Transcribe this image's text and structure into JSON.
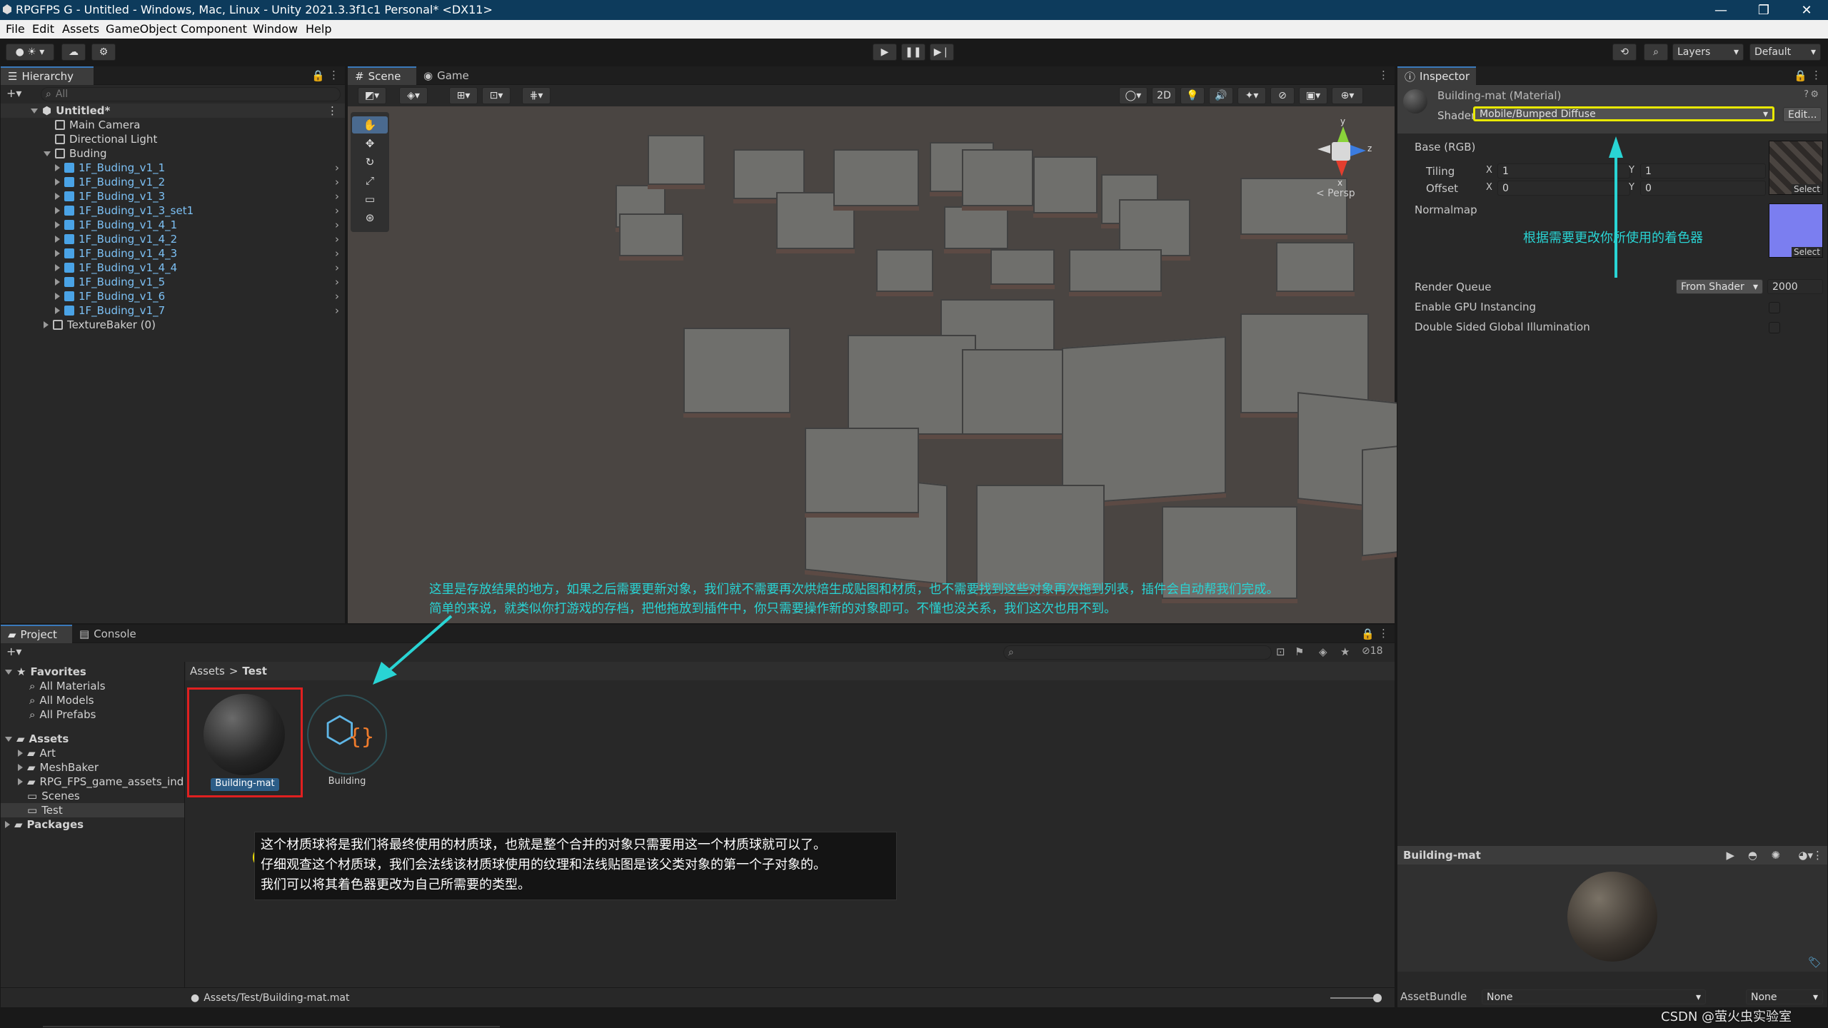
{
  "window": {
    "title": "RPGFPS G - Untitled - Windows, Mac, Linux - Unity 2021.3.3f1c1 Personal* <DX11>",
    "controls": [
      "—",
      "❐",
      "✕"
    ]
  },
  "menu": [
    "File",
    "Edit",
    "Assets",
    "GameObject",
    "Component",
    "Window",
    "Help"
  ],
  "toolbar": {
    "layers_label": "Layers",
    "layout_label": "Default"
  },
  "hierarchy": {
    "tab": "Hierarchy",
    "search_placeholder": "All",
    "scene_name": "Untitled*",
    "items": [
      "Main Camera",
      "Directional Light",
      "Buding"
    ],
    "children": [
      "1F_Buding_v1_1",
      "1F_Buding_v1_2",
      "1F_Buding_v1_3",
      "1F_Buding_v1_3_set1",
      "1F_Buding_v1_4_1",
      "1F_Buding_v1_4_2",
      "1F_Buding_v1_4_3",
      "1F_Buding_v1_4_4",
      "1F_Buding_v1_5",
      "1F_Buding_v1_6",
      "1F_Buding_v1_7"
    ],
    "last_item": "TextureBaker (0)"
  },
  "scene": {
    "tab_scene": "Scene",
    "tab_game": "Game",
    "mode_2d": "2D",
    "persp": "< Persp",
    "gizmo_y": "y",
    "gizmo_z": "z",
    "gizmo_x": "x",
    "annotation_line1": "这里是存放结果的地方，如果之后需要更新对象，我们就不需要再次烘焙生成贴图和材质，也不需要找到这些对象再次拖到列表，插件会自动帮我们完成。",
    "annotation_line2": "简单的来说，就类似你打游戏的存档，把他拖放到插件中，你只需要操作新的对象即可。不懂也没关系，我们这次也用不到。"
  },
  "project": {
    "tab_project": "Project",
    "tab_console": "Console",
    "favorites_label": "Favorites",
    "favorites": [
      "All Materials",
      "All Models",
      "All Prefabs"
    ],
    "assets_label": "Assets",
    "folders": [
      "Art",
      "MeshBaker",
      "RPG_FPS_game_assets_indu",
      "Scenes",
      "Test"
    ],
    "packages_label": "Packages",
    "breadcrumb_root": "Assets",
    "breadcrumb_sep": ">",
    "breadcrumb_current": "Test",
    "asset_material": "Building-mat",
    "asset_prefab": "Building",
    "hidden_count": "18",
    "status_path": "Assets/Test/Building-mat.mat",
    "note_number": "1",
    "note_line1": "这个材质球将是我们将最终使用的材质球，也就是整个合并的对象只需要用这一个材质球就可以了。",
    "note_line2": "仔细观查这个材质球，我们会法线该材质球使用的纹理和法线贴图是该父类对象的第一个子对象的。",
    "note_line3": "我们可以将其着色器更改为自己所需要的类型。"
  },
  "inspector": {
    "tab": "Inspector",
    "material_name": "Building-mat (Material)",
    "shader_label": "Shader",
    "shader_value": "Mobile/Bumped Diffuse",
    "edit_button": "Edit...",
    "base_label": "Base (RGB)",
    "tiling_label": "Tiling",
    "offset_label": "Offset",
    "axis_x": "X",
    "axis_y": "Y",
    "tiling_x": "1",
    "tiling_y": "1",
    "offset_x": "0",
    "offset_y": "0",
    "select_label": "Select",
    "normalmap_label": "Normalmap",
    "shader_hint": "根据需要更改你所使用的着色器",
    "render_queue_label": "Render Queue",
    "render_queue_mode": "From Shader",
    "render_queue_value": "2000",
    "gpu_instancing_label": "Enable GPU Instancing",
    "double_sided_label": "Double Sided Global Illumination",
    "preview_title": "Building-mat",
    "assetbundle_label": "AssetBundle",
    "assetbundle_name": "None",
    "assetbundle_variant": "None"
  },
  "watermark": "CSDN @萤火虫实验室",
  "colors": {
    "title_bg": "#0d3b5c",
    "accent_blue": "#3a79bb",
    "annotation_cyan": "#29d4d4",
    "highlight_yellow": "#e8e800",
    "highlight_red": "#e02020"
  }
}
